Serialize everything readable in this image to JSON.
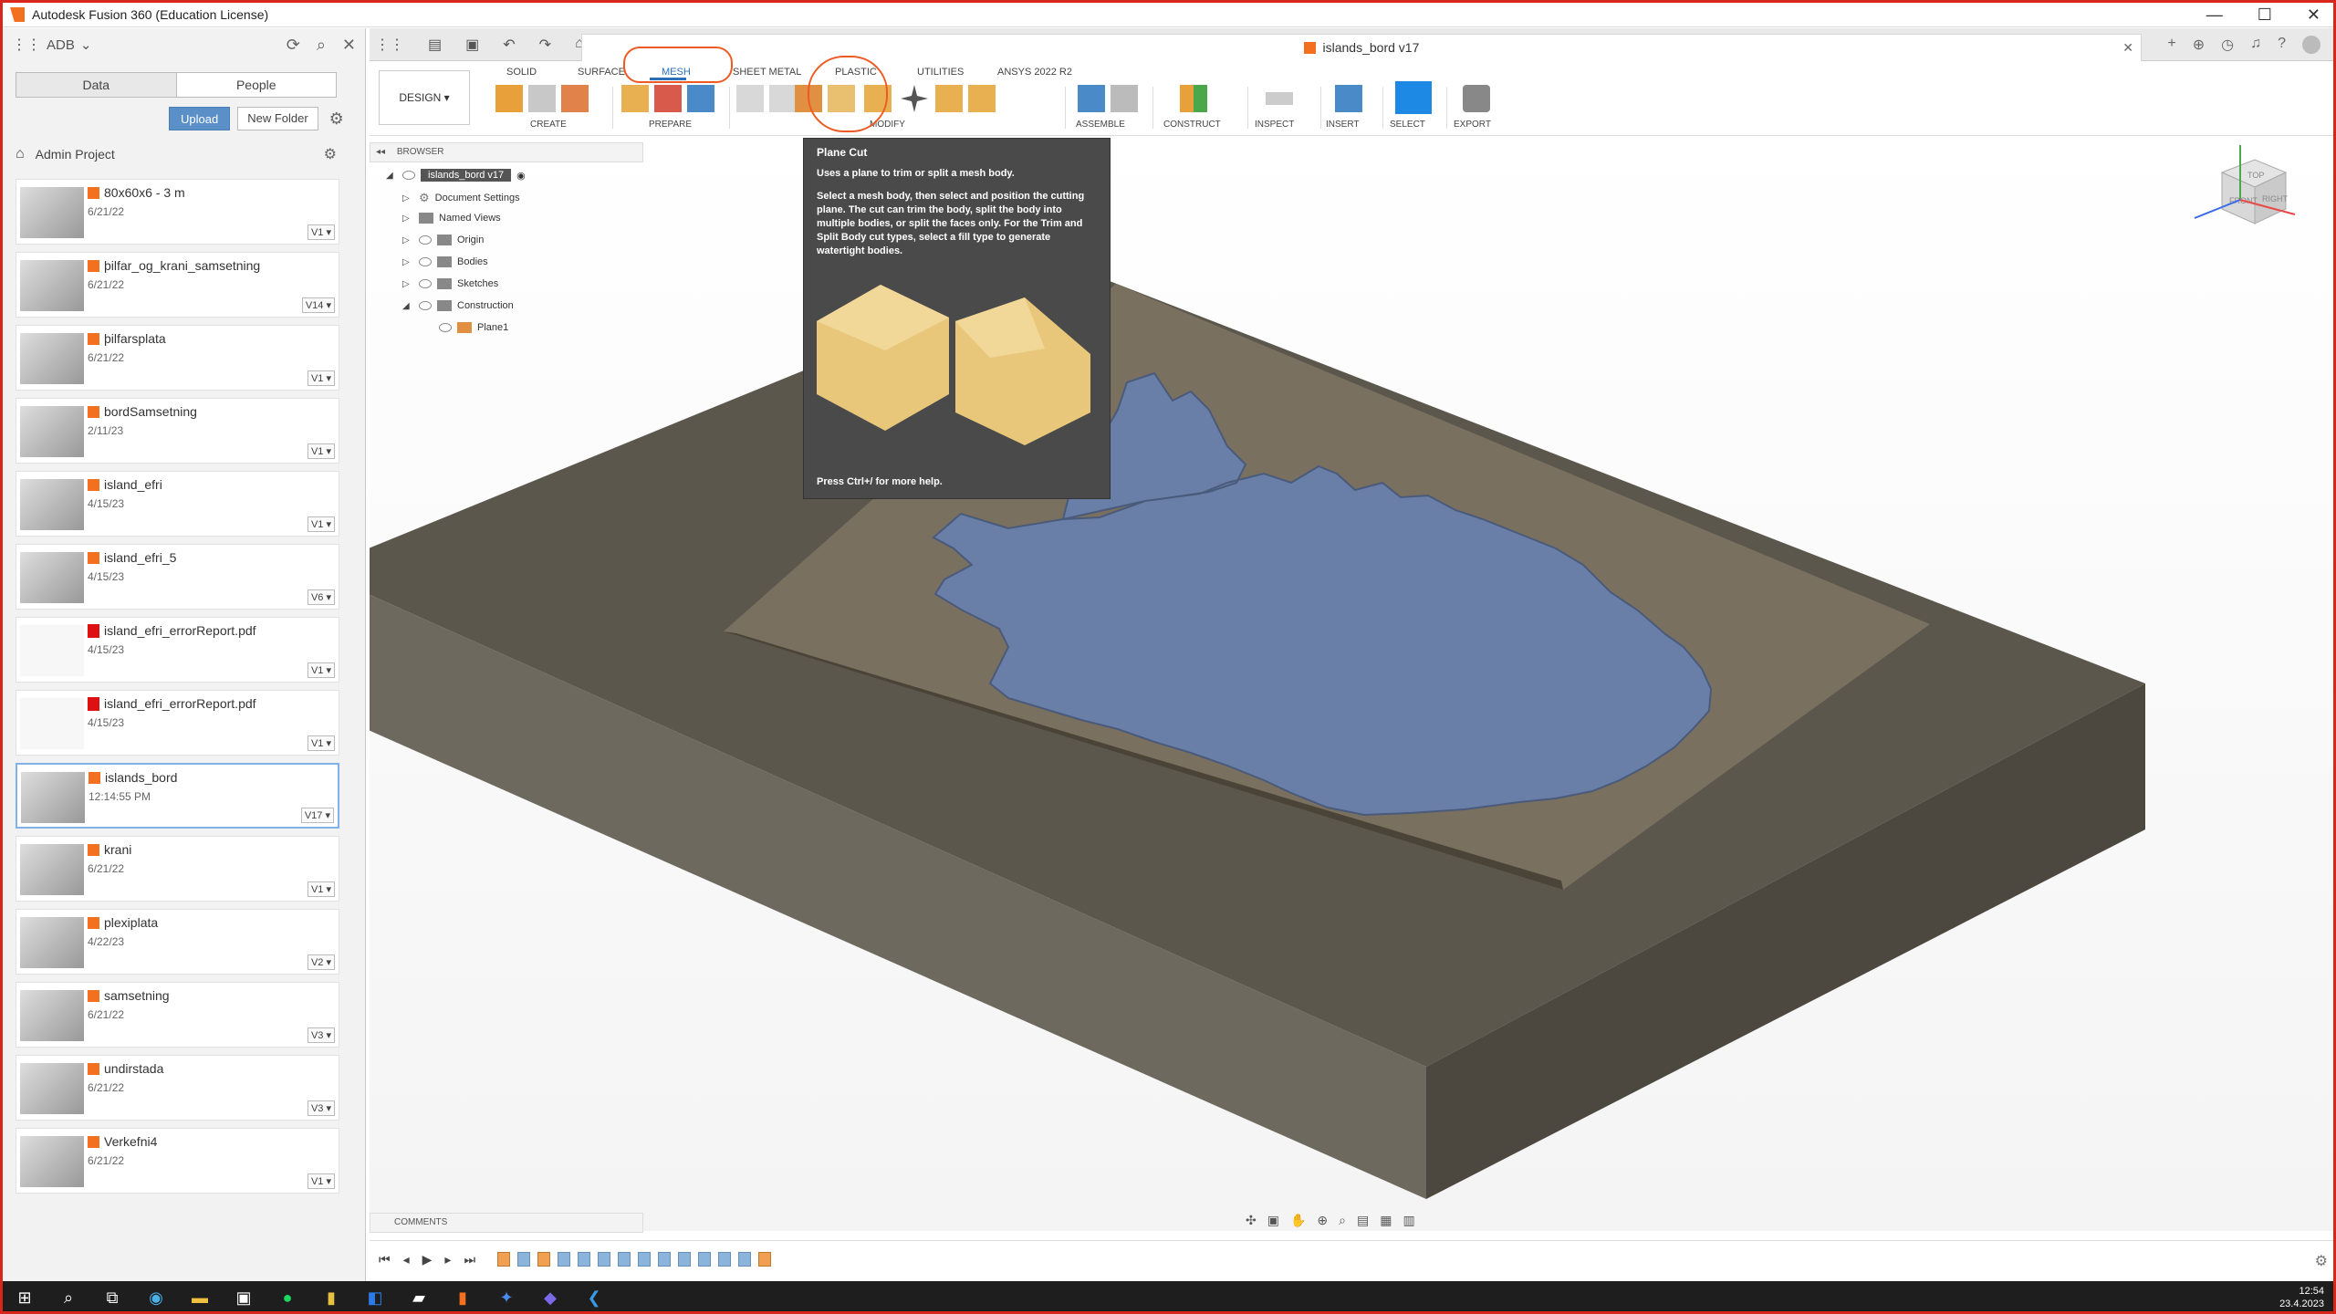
{
  "window": {
    "title": "Autodesk Fusion 360 (Education License)"
  },
  "left_panel": {
    "account": "ADB",
    "tabs": [
      "Data",
      "People"
    ],
    "upload_label": "Upload",
    "new_folder_label": "New Folder",
    "project": "Admin Project",
    "files": [
      {
        "name": "80x60x6 - 3 m",
        "date": "6/21/22",
        "version": "V1",
        "type": "design"
      },
      {
        "name": "þilfar_og_krani_samsetning",
        "date": "6/21/22",
        "version": "V14",
        "type": "design"
      },
      {
        "name": "þilfarsplata",
        "date": "6/21/22",
        "version": "V1",
        "type": "design"
      },
      {
        "name": "bordSamsetning",
        "date": "2/11/23",
        "version": "V1",
        "type": "design"
      },
      {
        "name": "island_efri",
        "date": "4/15/23",
        "version": "V1",
        "type": "design"
      },
      {
        "name": "island_efri_5",
        "date": "4/15/23",
        "version": "V6",
        "type": "design"
      },
      {
        "name": "island_efri_errorReport.pdf",
        "date": "4/15/23",
        "version": "V1",
        "type": "pdf"
      },
      {
        "name": "island_efri_errorReport.pdf",
        "date": "4/15/23",
        "version": "V1",
        "type": "pdf"
      },
      {
        "name": "islands_bord",
        "date": "12:14:55 PM",
        "version": "V17",
        "type": "design",
        "selected": true
      },
      {
        "name": "krani",
        "date": "6/21/22",
        "version": "V1",
        "type": "design"
      },
      {
        "name": "plexiplata",
        "date": "4/22/23",
        "version": "V2",
        "type": "design"
      },
      {
        "name": "samsetning",
        "date": "6/21/22",
        "version": "V3",
        "type": "design"
      },
      {
        "name": "undirstada",
        "date": "6/21/22",
        "version": "V3",
        "type": "design"
      },
      {
        "name": "Verkefni4",
        "date": "6/21/22",
        "version": "V1",
        "type": "design"
      }
    ]
  },
  "doc_tab": {
    "title": "islands_bord v17"
  },
  "toolbar": {
    "workspace": "DESIGN",
    "ribbon_tabs": [
      "SOLID",
      "SURFACE",
      "MESH",
      "SHEET METAL",
      "PLASTIC",
      "UTILITIES",
      "ANSYS 2022 R2"
    ],
    "active_tab": "MESH",
    "groups": [
      "CREATE",
      "PREPARE",
      "MODIFY",
      "ASSEMBLE",
      "CONSTRUCT",
      "INSPECT",
      "INSERT",
      "SELECT",
      "EXPORT"
    ]
  },
  "browser": {
    "header": "BROWSER",
    "root": "islands_bord v17",
    "nodes": [
      "Document Settings",
      "Named Views",
      "Origin",
      "Bodies",
      "Sketches",
      "Construction",
      "Plane1"
    ]
  },
  "tooltip": {
    "title": "Plane Cut",
    "subtitle": "Uses a plane to trim or split a mesh body.",
    "body": "Select a mesh body, then select and position the cutting plane. The cut can trim the body, split the body into multiple bodies, or split the faces only. For the Trim and Split Body cut types, select a fill type to generate watertight bodies.",
    "footer": "Press Ctrl+/ for more help."
  },
  "comments": {
    "label": "COMMENTS"
  },
  "viewcube": {
    "top": "TOP",
    "front": "FRONT",
    "right": "RIGHT"
  },
  "clock": {
    "time": "12:54",
    "date": "23.4.2023"
  },
  "colors": {
    "accent": "#2a6fb8",
    "brand": "#f37021",
    "annotation": "#ee5a24",
    "frame": "#d9261c"
  }
}
